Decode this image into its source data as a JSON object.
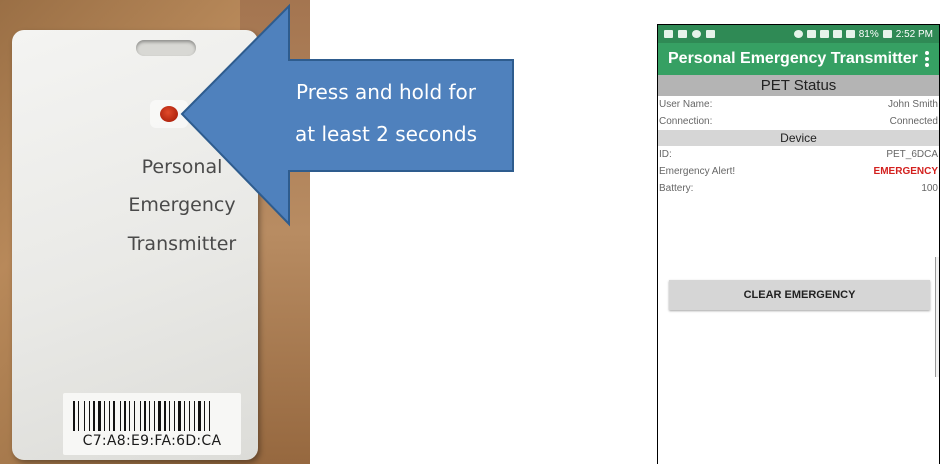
{
  "device_photo": {
    "card_lines": [
      "Personal",
      "Emergency",
      "Transmitter"
    ],
    "mac_label": "C7:A8:E9:FA:6D:CA"
  },
  "callout": {
    "line1": "Press and hold for",
    "line2": "at least 2 seconds",
    "color": "#4f81bd"
  },
  "phone": {
    "status_bar": {
      "battery": "81%",
      "time": "2:52 PM"
    },
    "app_title": "Personal Emergency Transmitter",
    "pet_status_header": "PET Status",
    "user_name_label": "User Name:",
    "user_name_value": "John Smith",
    "connection_label": "Connection:",
    "connection_value": "Connected",
    "device_header": "Device",
    "id_label": "ID:",
    "id_value": "PET_6DCA",
    "alert_label": "Emergency Alert!",
    "alert_value": "EMERGENCY",
    "battery_label": "Battery:",
    "battery_value": "100",
    "clear_button": "CLEAR EMERGENCY",
    "colors": {
      "status_bar": "#2f8a55",
      "app_bar": "#36a063",
      "alert": "#d3201e"
    }
  }
}
